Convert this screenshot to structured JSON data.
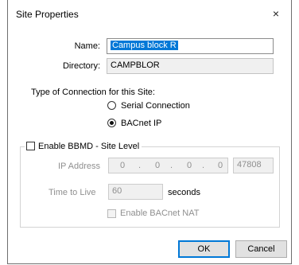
{
  "dialog": {
    "title": "Site Properties",
    "close_glyph": "×"
  },
  "name": {
    "label": "Name:",
    "value": "Campus block R"
  },
  "directory": {
    "label": "Directory:",
    "value": "CAMPBLOR"
  },
  "connection": {
    "heading": "Type of Connection for this Site:",
    "options": [
      {
        "label": "Serial Connection",
        "selected": false
      },
      {
        "label": "BACnet IP",
        "selected": true
      }
    ]
  },
  "bbmd": {
    "checkbox_label": "Enable BBMD - Site Level",
    "checked": false,
    "ip_label": "IP Address",
    "ip_octets": [
      "0",
      "0",
      "0",
      "0"
    ],
    "ip_separator": ".",
    "port": "47808",
    "ttl_label": "Time to Live",
    "ttl_value": "60",
    "ttl_unit": "seconds",
    "nat_label": "Enable BACnet NAT",
    "nat_checked": false
  },
  "buttons": {
    "ok": "OK",
    "cancel": "Cancel"
  }
}
